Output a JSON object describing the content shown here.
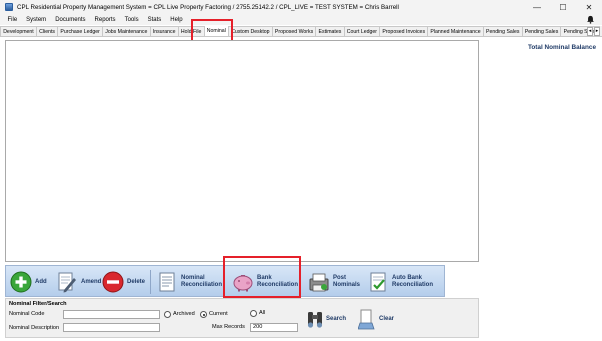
{
  "window": {
    "title": "CPL Residential Property Management System  =  CPL Live Property Factoring  /  2755.25142.2  /  CPL_LIVE  =  TEST SYSTEM  =  Chris Barrell",
    "minimize": "—",
    "maximize": "☐",
    "close": "✕"
  },
  "menu": [
    "File",
    "System",
    "Documents",
    "Reports",
    "Tools",
    "Stats",
    "Help"
  ],
  "tabs": [
    "Development",
    "Clients",
    "Purchase Ledger",
    "Jobs Maintenance",
    "Insurance",
    "Hold File",
    "Nominal",
    "Custom Desktop",
    "Proposed Works",
    "Estimates",
    "Court Ledger",
    "Proposed Invoices",
    "Planned Maintenance",
    "Pending Sales",
    "Pending Sales",
    "Pending Sales"
  ],
  "active_tab": "Nominal",
  "tab_scroll": {
    "left": "◂",
    "right": "▸"
  },
  "right_panel": {
    "title": "Total Nominal Balance"
  },
  "toolbar": {
    "add": "Add",
    "amend": "Amend",
    "delete": "Delete",
    "nominal_reconciliation": "Nominal\nReconciliation",
    "bank_reconciliation": "Bank\nReconciliation",
    "post_nominals": "Post\nNominals",
    "auto_bank_reconciliation": "Auto Bank\nReconciliation"
  },
  "filter": {
    "title": "Nominal Filter/Search",
    "nominal_code_label": "Nominal Code",
    "nominal_code_value": "",
    "nominal_description_label": "Nominal Description",
    "nominal_description_value": "",
    "status_options": [
      "Archived",
      "Current",
      "All"
    ],
    "status_selected": "Current",
    "max_records_label": "Max Records",
    "max_records_value": "200",
    "search_label": "Search",
    "clear_label": "Clear"
  },
  "colors": {
    "highlight": "#e5202a",
    "toolbar_label": "#1f3a66",
    "right_panel_title": "#1f3a66"
  }
}
